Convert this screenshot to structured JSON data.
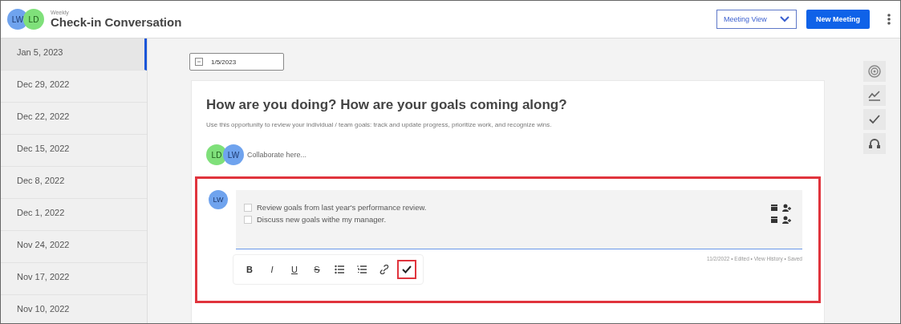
{
  "header": {
    "avatars": [
      {
        "initials": "LW",
        "color": "#6fa3ee"
      },
      {
        "initials": "LD",
        "color": "#7fe07a"
      }
    ],
    "subtitle": "Weekly",
    "title": "Check-in Conversation",
    "view_select": "Meeting View",
    "new_button": "New Meeting"
  },
  "sidebar": {
    "items": [
      {
        "label": "Jan 5, 2023",
        "selected": true
      },
      {
        "label": "Dec 29, 2022",
        "selected": false
      },
      {
        "label": "Dec 22, 2022",
        "selected": false
      },
      {
        "label": "Dec 15, 2022",
        "selected": false
      },
      {
        "label": "Dec 8, 2022",
        "selected": false
      },
      {
        "label": "Dec 1, 2022",
        "selected": false
      },
      {
        "label": "Nov 24, 2022",
        "selected": false
      },
      {
        "label": "Nov 17, 2022",
        "selected": false
      },
      {
        "label": "Nov 10, 2022",
        "selected": false
      }
    ]
  },
  "date_field": {
    "value": "1/5/2023"
  },
  "card": {
    "heading": "How are you doing? How are your goals coming along?",
    "description": "Use this opportunity to review your individual / team goals: track and update progress, prioritize work, and recognize wins.",
    "collaborators": [
      {
        "initials": "LD",
        "color": "#7fe07a"
      },
      {
        "initials": "LW",
        "color": "#6fa3ee"
      }
    ],
    "collaborate_placeholder": "Collaborate here...",
    "entry": {
      "author": {
        "initials": "LW",
        "color": "#6fa3ee"
      },
      "highlighted": true,
      "tasks": [
        {
          "text": "Review goals from last year's performance review.",
          "checked": false
        },
        {
          "text": "Discuss new goals withe my manager.",
          "checked": false
        }
      ],
      "meta": "11/2/2022 • Edited • View History • Saved",
      "toolbar": [
        {
          "kind": "bold",
          "label": "B",
          "highlighted": false
        },
        {
          "kind": "italic",
          "label": "I",
          "highlighted": false
        },
        {
          "kind": "underline",
          "label": "U",
          "highlighted": false
        },
        {
          "kind": "strike",
          "label": "S",
          "highlighted": false
        },
        {
          "kind": "bullets",
          "highlighted": false
        },
        {
          "kind": "numbers",
          "highlighted": false
        },
        {
          "kind": "link",
          "highlighted": false
        },
        {
          "kind": "check",
          "highlighted": true
        }
      ]
    }
  },
  "rail": [
    {
      "kind": "target"
    },
    {
      "kind": "chart"
    },
    {
      "kind": "check"
    },
    {
      "kind": "headset"
    }
  ]
}
